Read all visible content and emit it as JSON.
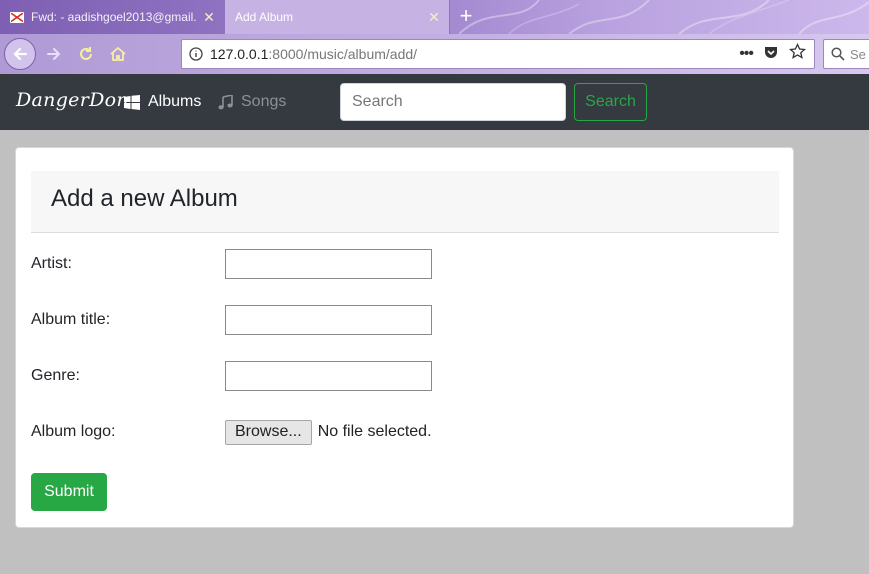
{
  "browser": {
    "tabs": [
      {
        "label": "Fwd: - aadishgoel2013@gmail.",
        "active": false
      },
      {
        "label": "Add Album",
        "active": true
      }
    ],
    "url_host": "127.0.0.1",
    "url_path": ":8000/music/album/add/",
    "search_placeholder": "Se"
  },
  "site": {
    "brand": "DangerDon",
    "nav": [
      {
        "label": "Albums",
        "icon": "windows-icon",
        "active": true
      },
      {
        "label": "Songs",
        "icon": "music-note-icon",
        "active": false
      }
    ],
    "search_placeholder": "Search",
    "search_button": "Search"
  },
  "form": {
    "title": "Add a new Album",
    "fields": [
      {
        "label": "Artist:",
        "value": ""
      },
      {
        "label": "Album title:",
        "value": ""
      },
      {
        "label": "Genre:",
        "value": ""
      }
    ],
    "logo": {
      "label": "Album logo:",
      "button": "Browse...",
      "status": "No file selected."
    },
    "submit": "Submit"
  },
  "colors": {
    "accent": "#28a745",
    "navbar": "#343a40",
    "tabstrip": "#9c80cb"
  }
}
